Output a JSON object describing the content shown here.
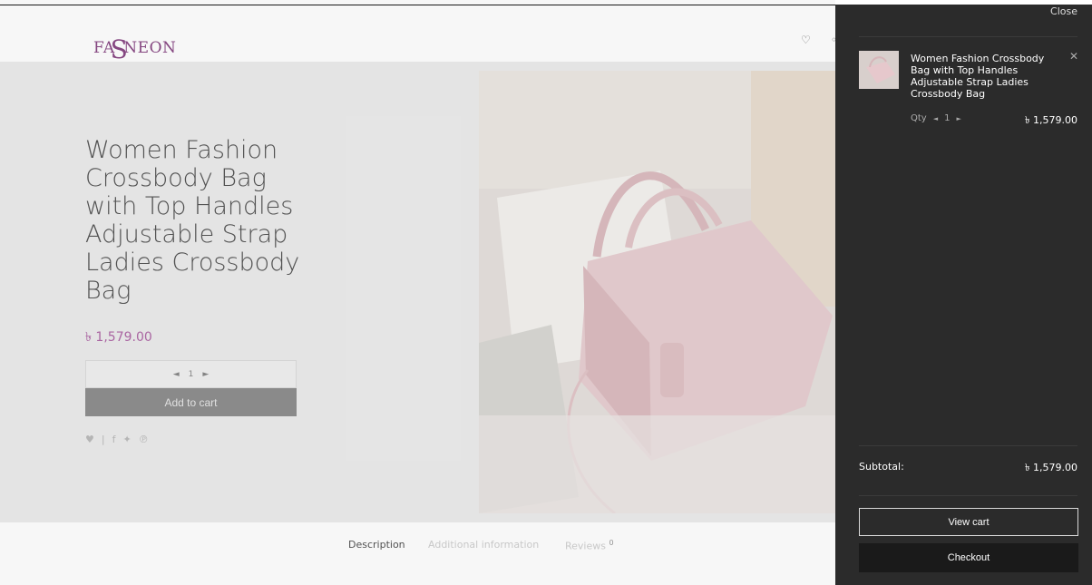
{
  "header": {
    "logo_text_left": "FA",
    "logo_text_s": "S",
    "logo_text_right": "NEON",
    "wishlist_icon": "heart-icon"
  },
  "product": {
    "title": "Women Fashion Crossbody Bag with Top Handles Adjustable Strap Ladies Crossbody Bag",
    "price": "৳ 1,579.00",
    "quantity": "1",
    "add_to_cart_label": "Add to cart",
    "image_icon": "product-photo",
    "social_icons": [
      "heart-icon",
      "facebook-icon",
      "twitter-icon",
      "pinterest-icon"
    ]
  },
  "tabs": {
    "description": "Description",
    "additional": "Additional information",
    "reviews": "Reviews",
    "reviews_count": "0"
  },
  "cart": {
    "close_label": "Close",
    "item": {
      "name": "Women Fashion Crossbody Bag with Top Handles Adjustable Strap Ladies Crossbody Bag",
      "qty_label": "Qty",
      "quantity": "1",
      "price": "৳ 1,579.00",
      "remove_icon": "close-icon"
    },
    "subtotal_label": "Subtotal:",
    "subtotal_value": "৳ 1,579.00",
    "view_cart_label": "View cart",
    "checkout_label": "Checkout"
  },
  "colors": {
    "drawer_bg": "#2b2b2b",
    "accent": "#b06aa8",
    "checkout_bg": "#1a1a1a"
  }
}
